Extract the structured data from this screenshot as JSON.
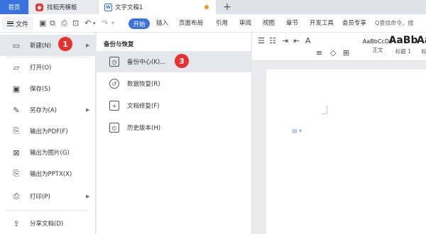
{
  "tabs": {
    "home": "首页",
    "template": "找稻壳模板",
    "document": "文字文稿1",
    "plus": "+"
  },
  "ribbon": {
    "file": "文件",
    "quick_icons": [
      "save-icon",
      "export-icon",
      "print-icon",
      "preview-icon",
      "undo-icon",
      "redo-icon"
    ],
    "start": "开始",
    "menus": [
      "插入",
      "页面布局",
      "引用",
      "审阅",
      "视图",
      "章节",
      "开发工具",
      "会员专享"
    ],
    "search": "Q查找命令、搜"
  },
  "styles": [
    {
      "sample": "AaBbCcDd",
      "label": "正文"
    },
    {
      "sample": "AaBb",
      "label": "标题 1"
    },
    {
      "sample": "Aa",
      "label": "标"
    }
  ],
  "file_menu": {
    "items": [
      {
        "label": "新建(N)",
        "icon": "new-icon",
        "arrow": "▶"
      },
      {
        "label": "打开(O)",
        "icon": "folder-icon",
        "arrow": ""
      },
      {
        "label": "保存(S)",
        "icon": "save-icon",
        "arrow": ""
      },
      {
        "label": "另存为(A)",
        "icon": "save-as-icon",
        "arrow": "▶"
      },
      {
        "label": "输出为PDF(F)",
        "icon": "pdf-icon",
        "arrow": ""
      },
      {
        "label": "输出为图片(G)",
        "icon": "image-icon",
        "arrow": ""
      },
      {
        "label": "输出为PPTX(X)",
        "icon": "pptx-icon",
        "arrow": ""
      },
      {
        "label": "打印(P)",
        "icon": "print-icon",
        "arrow": "▶"
      },
      {
        "label": "分享文档(D)",
        "icon": "share-icon",
        "arrow": ""
      }
    ]
  },
  "submenu": {
    "title": "备份与恢复",
    "items": [
      {
        "label": "备份中心(K)...",
        "icon": "backup-center-icon"
      },
      {
        "label": "数据恢复(R)",
        "icon": "data-recovery-icon"
      },
      {
        "label": "文档修复(F)",
        "icon": "document-repair-icon"
      },
      {
        "label": "历史版本(H)",
        "icon": "history-version-icon"
      }
    ]
  },
  "callouts": {
    "step1": "1",
    "step3": "3"
  },
  "colors": {
    "accent": "#3a73e0",
    "badge": "#e8302c",
    "highlight": "#e4e7ec"
  }
}
